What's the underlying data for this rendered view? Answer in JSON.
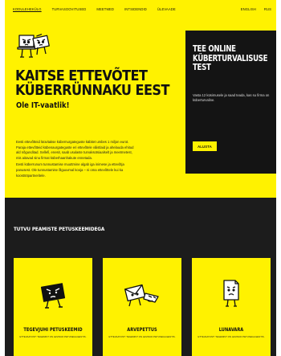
{
  "nav": {
    "left": [
      "KODULEHEKÜLG",
      "TURVASOOVITUSED",
      "MEETMED",
      "INTSIDENDID",
      "ÜLEVAADE"
    ],
    "right": [
      "ENGLISH",
      "RUS"
    ]
  },
  "hero": {
    "title_line1": "KAITSE ETTEVÕTET",
    "title_line2": "KÜBERRÜNNAKU EEST",
    "subtitle": "Ole IT-vaatlik!",
    "paragraphs": [
      "Eesti ettevõtteid lüüvitakse kübernurgateguste käbitet umbes 1 miljon eurot. Paraja ettevõtteid kübenaurgateguste eri ettevõtele vãistlaid ja ahelauda ehitud ald nõgunditad. Sellefi, enesit, saab usulaste turvaksotsiaalselt ja meetmetest, mis aitavad sinu firmat küberhaanhakute ennetada.",
      "Eesti küberrunum tunnustamise muuttmine algab iga inimese ja ettevõtja panusest. Ole tunnustamise õlguuvmal kooja – ni oma ettevõttele kui ka koostööpartneritele."
    ]
  },
  "test_card": {
    "title_lines": [
      "TEE ONLINE",
      "KÜBERTURVALISUSE",
      "TEST"
    ],
    "text": "Vasta 12 küsimusele ja saad teada, kas su firma on küberturvaline.",
    "button": "ALUSTA"
  },
  "schemes": {
    "heading": "TUTVU PEAMISTE PETUSKEEMIDEGA",
    "items": [
      {
        "title": "TEGEVJUHI PETUSKEEMID",
        "subtitle": "ETTEVAATUST! TEGEMIST ON LEVINUD PETUSEGA EESTIS."
      },
      {
        "title": "ARVEPETTUS",
        "subtitle": "ETTEVAATUST! TEGEMIST ON LEVINUD PETUSEGA EESTIS."
      },
      {
        "title": "LUNAVARA",
        "subtitle": "ETTEVAATUST! TEGEMIST ON LEVINUD PETUSEGA EESTIS."
      }
    ]
  },
  "colors": {
    "accent": "#fff200",
    "dark": "#141414",
    "band": "#1c1c1c"
  },
  "icons": [
    "laptop-mascot-icon",
    "briefcase-mascot-icon",
    "envelope-mascot-icon",
    "document-mascot-icon"
  ]
}
